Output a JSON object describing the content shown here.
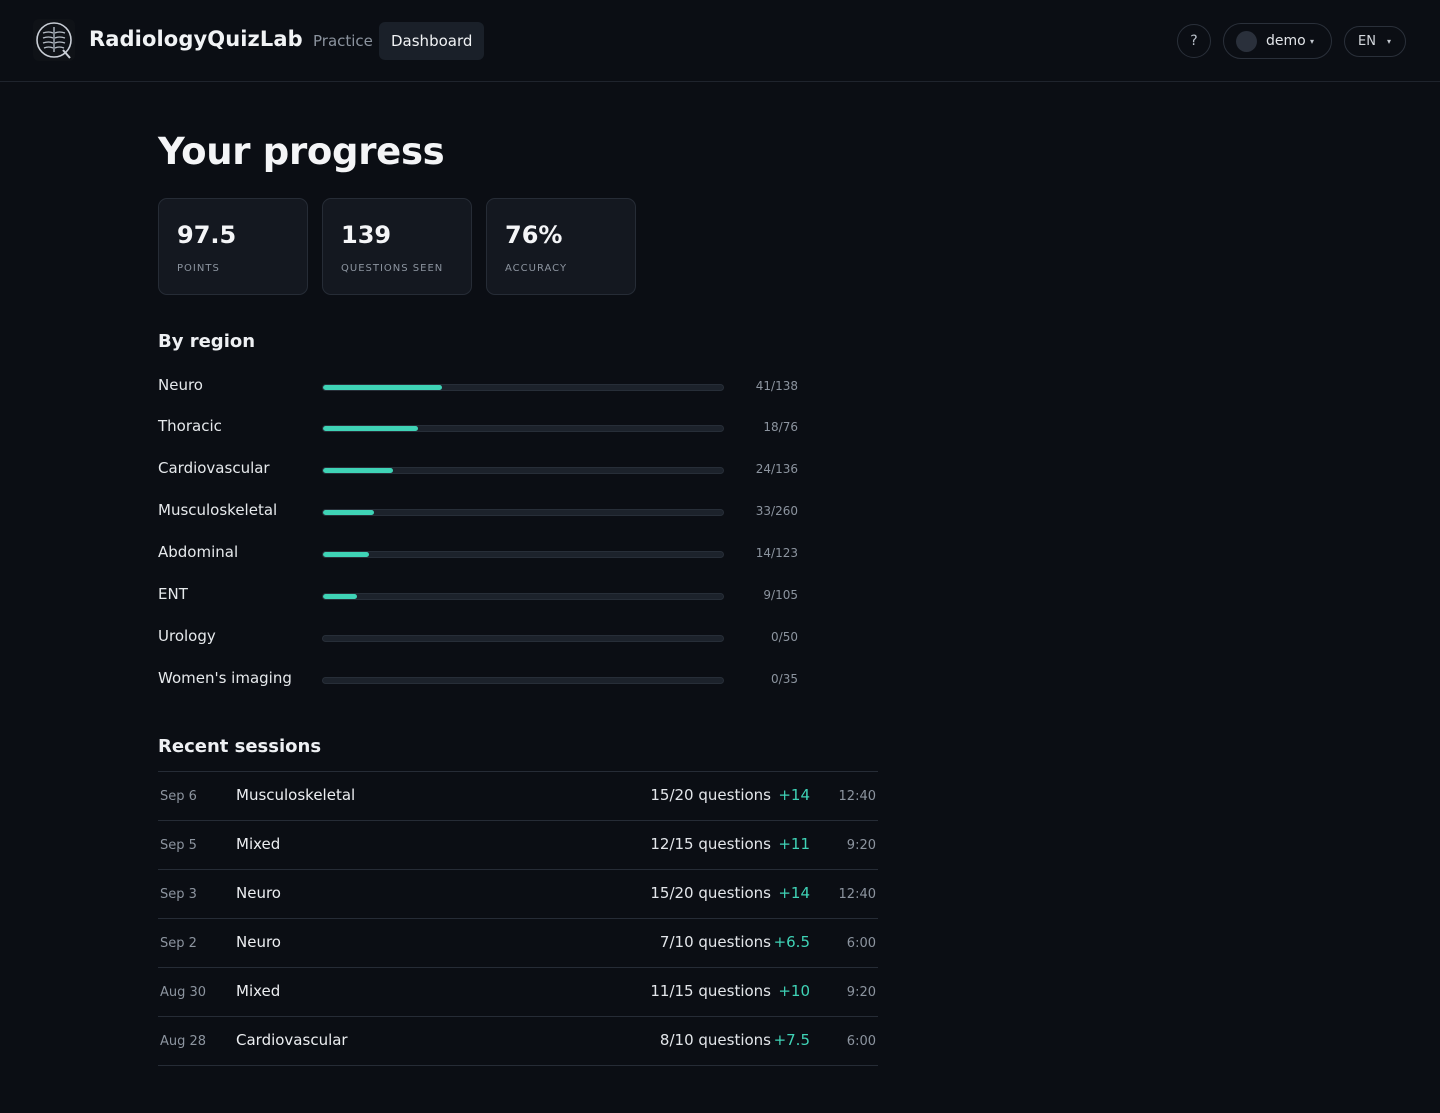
{
  "header": {
    "brand": "RadiologyQuizLab",
    "logo_icon": "xray-chest-icon",
    "nav": [
      {
        "label": "Practice",
        "active": false
      },
      {
        "label": "Dashboard",
        "active": true
      }
    ],
    "help_label": "?",
    "user": {
      "name": "demo",
      "caret": "▾"
    },
    "language": {
      "code": "EN",
      "caret": "▾"
    }
  },
  "page": {
    "title": "Your progress"
  },
  "stats": [
    {
      "value": "97.5",
      "label": "POINTS"
    },
    {
      "value": "139",
      "label": "QUESTIONS SEEN"
    },
    {
      "value": "76%",
      "label": "ACCURACY"
    }
  ],
  "by_region": {
    "title": "By region",
    "accent": "#3fd3b6",
    "regions": [
      {
        "name": "Neuro",
        "count": "41/138",
        "progress": 0.297
      },
      {
        "name": "Thoracic",
        "count": "18/76",
        "progress": 0.237
      },
      {
        "name": "Cardiovascular",
        "count": "24/136",
        "progress": 0.176
      },
      {
        "name": "Musculoskeletal",
        "count": "33/260",
        "progress": 0.127
      },
      {
        "name": "Abdominal",
        "count": "14/123",
        "progress": 0.114
      },
      {
        "name": "ENT",
        "count": "9/105",
        "progress": 0.086
      },
      {
        "name": "Urology",
        "count": "0/50",
        "progress": 0
      },
      {
        "name": "Women's imaging",
        "count": "0/35",
        "progress": 0
      }
    ]
  },
  "recent_sessions": {
    "title": "Recent sessions",
    "rows": [
      {
        "date": "Sep 6",
        "topic": "Musculoskeletal",
        "questions": "15/20 questions",
        "points": "+14",
        "time": "12:40"
      },
      {
        "date": "Sep 5",
        "topic": "Mixed",
        "questions": "12/15 questions",
        "points": "+11",
        "time": "9:20"
      },
      {
        "date": "Sep 3",
        "topic": "Neuro",
        "questions": "15/20 questions",
        "points": "+14",
        "time": "12:40"
      },
      {
        "date": "Sep 2",
        "topic": "Neuro",
        "questions": "7/10 questions",
        "points": "+6.5",
        "time": "6:00"
      },
      {
        "date": "Aug 30",
        "topic": "Mixed",
        "questions": "11/15 questions",
        "points": "+10",
        "time": "9:20"
      },
      {
        "date": "Aug 28",
        "topic": "Cardiovascular",
        "questions": "8/10 questions",
        "points": "+7.5",
        "time": "6:00"
      }
    ]
  }
}
